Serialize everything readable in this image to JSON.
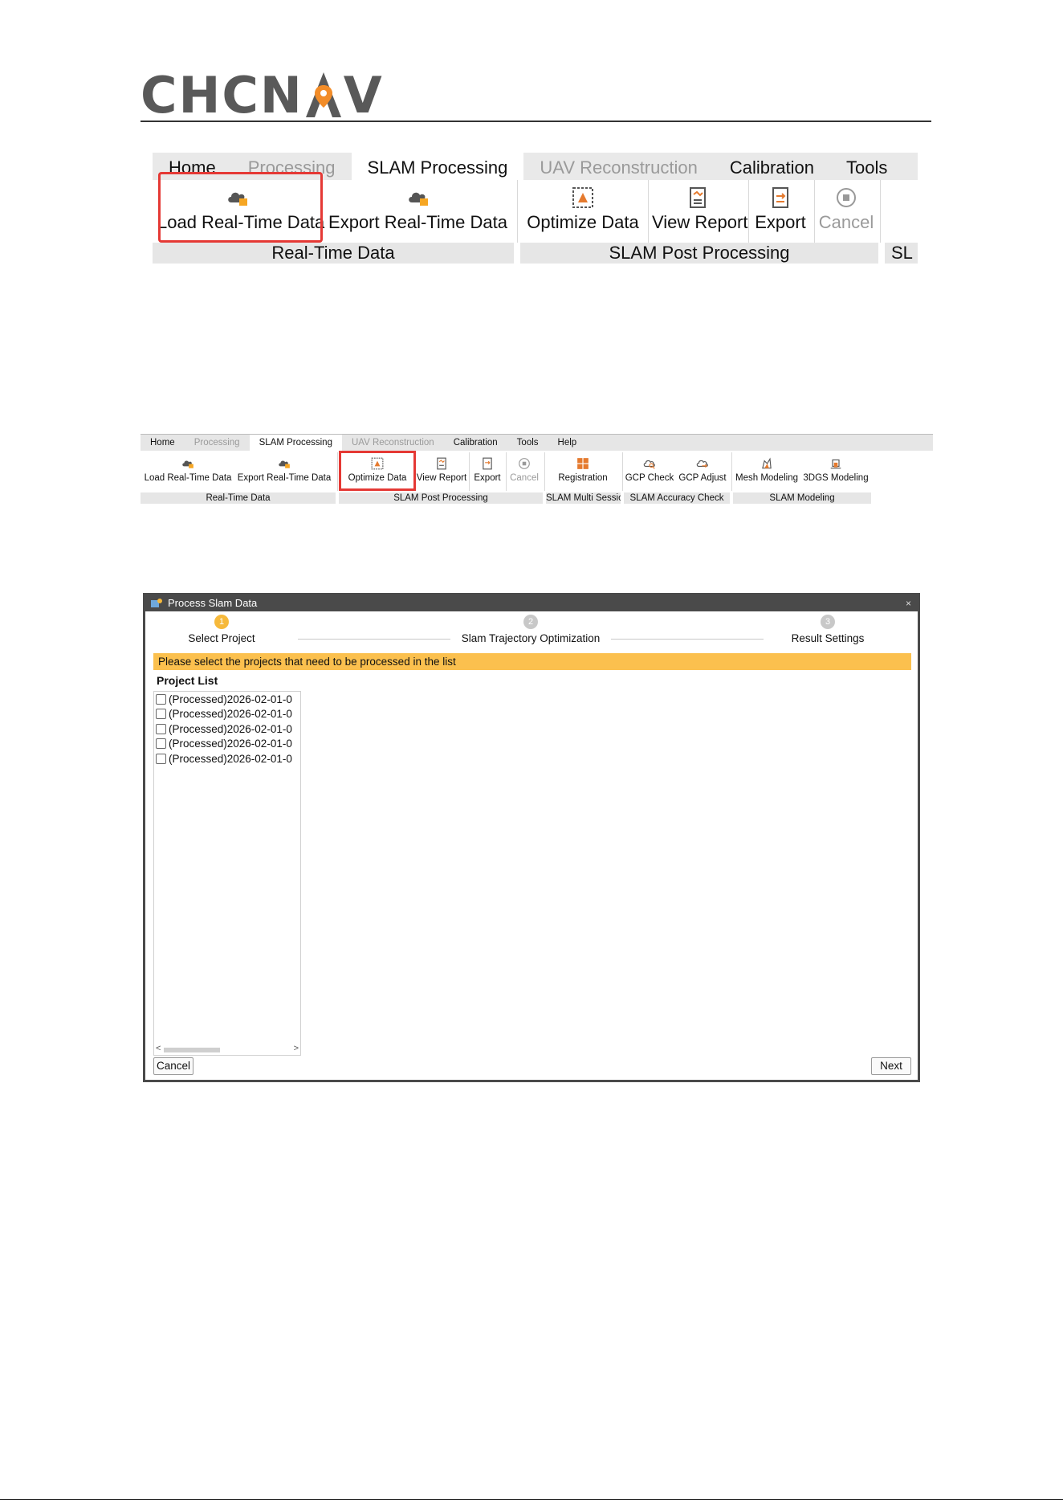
{
  "logo": {
    "text_before": "CHCN",
    "text_after": "V",
    "accent": "#f28c28",
    "gray": "#595959"
  },
  "ribbon_large": {
    "tabs": [
      {
        "label": "Home",
        "state": "normal"
      },
      {
        "label": "Processing",
        "state": "disabled"
      },
      {
        "label": "SLAM Processing",
        "state": "active"
      },
      {
        "label": "UAV Reconstruction",
        "state": "disabled"
      },
      {
        "label": "Calibration",
        "state": "normal"
      },
      {
        "label": "Tools",
        "state": "normal"
      }
    ],
    "buttons": {
      "load": "Load Real-Time Data",
      "export_rt": "Export Real-Time Data",
      "optimize": "Optimize Data",
      "view_report": "View Report",
      "export": "Export",
      "cancel": "Cancel"
    },
    "groups": {
      "realtime": "Real-Time Data",
      "post": "SLAM Post Processing",
      "cut": "SL"
    }
  },
  "ribbon_small": {
    "tabs": [
      {
        "label": "Home",
        "state": "normal"
      },
      {
        "label": "Processing",
        "state": "disabled"
      },
      {
        "label": "SLAM Processing",
        "state": "active"
      },
      {
        "label": "UAV Reconstruction",
        "state": "disabled"
      },
      {
        "label": "Calibration",
        "state": "normal"
      },
      {
        "label": "Tools",
        "state": "normal"
      },
      {
        "label": "Help",
        "state": "normal"
      }
    ],
    "buttons": {
      "load": "Load Real-Time Data",
      "export_rt": "Export Real-Time Data",
      "optimize": "Optimize Data",
      "view_report": "View Report",
      "export": "Export",
      "cancel": "Cancel",
      "registration": "Registration",
      "gcp_check": "GCP Check",
      "gcp_adjust": "GCP Adjust",
      "mesh": "Mesh Modeling",
      "gs3d": "3DGS Modeling"
    },
    "groups": {
      "realtime": "Real-Time Data",
      "post": "SLAM Post Processing",
      "multi": "SLAM Multi Session",
      "accuracy": "SLAM Accuracy Check",
      "modeling": "SLAM Modeling"
    }
  },
  "dialog": {
    "title": "Process Slam Data",
    "close": "×",
    "steps": [
      {
        "num": "1",
        "label": "Select Project",
        "active": true
      },
      {
        "num": "2",
        "label": "Slam Trajectory Optimization",
        "active": false
      },
      {
        "num": "3",
        "label": "Result Settings",
        "active": false
      }
    ],
    "banner": "Please select the projects that need to be processed in the list",
    "list_title": "Project List",
    "projects": [
      "(Processed)2026-02-01-0",
      "(Processed)2026-02-01-0",
      "(Processed)2026-02-01-0",
      "(Processed)2026-02-01-0",
      "(Processed)2026-02-01-0"
    ],
    "scroll_left": "<",
    "scroll_right": ">",
    "cancel": "Cancel",
    "next": "Next"
  },
  "colors": {
    "highlight": "#e53935",
    "banner": "#fbc04e",
    "step_active": "#f6b93b"
  }
}
